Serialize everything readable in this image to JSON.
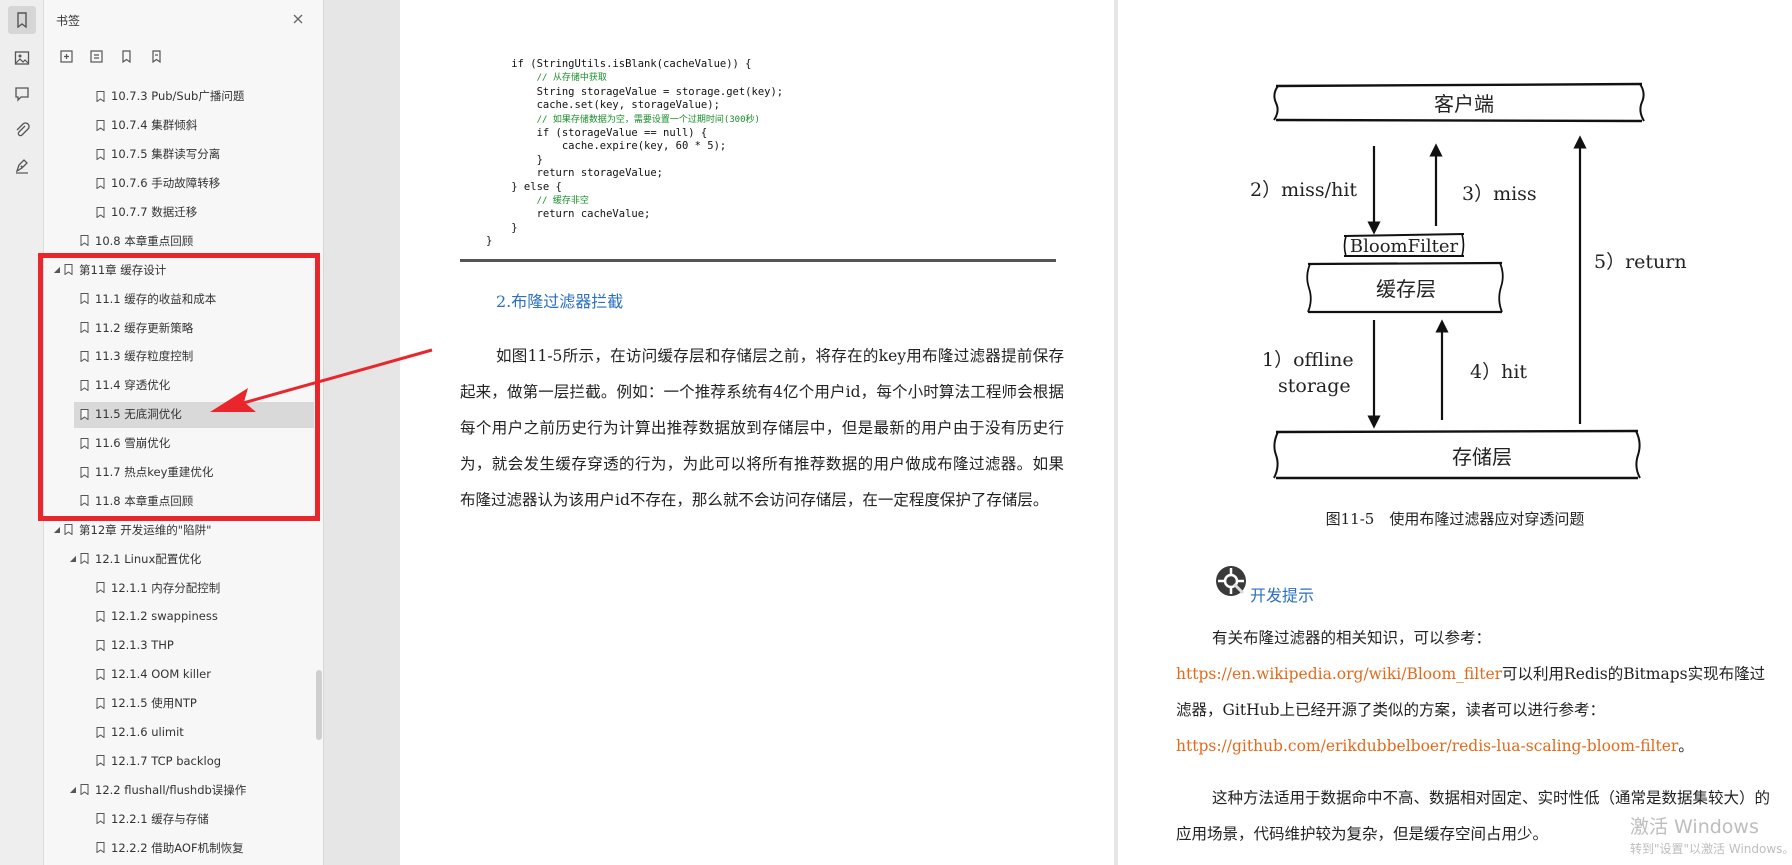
{
  "rail": {
    "items": [
      "bookmark-icon",
      "image-icon",
      "comment-icon",
      "attachment-icon",
      "signature-icon"
    ]
  },
  "panel": {
    "title": "书签",
    "tools": [
      "add-bookmark-icon",
      "delete-bookmark-icon",
      "expand-bookmark-icon",
      "collapse-bookmark-icon"
    ]
  },
  "tree": [
    {
      "label": "10.7.3 Pub/Sub广播问题",
      "level": 3,
      "caret": ""
    },
    {
      "label": "10.7.4 集群倾斜",
      "level": 3,
      "caret": ""
    },
    {
      "label": "10.7.5 集群读写分离",
      "level": 3,
      "caret": ""
    },
    {
      "label": "10.7.6 手动故障转移",
      "level": 3,
      "caret": ""
    },
    {
      "label": "10.7.7 数据迁移",
      "level": 3,
      "caret": ""
    },
    {
      "label": "10.8 本章重点回顾",
      "level": 2,
      "caret": ""
    },
    {
      "label": "第11章 缓存设计",
      "level": 1,
      "caret": "▲"
    },
    {
      "label": "11.1 缓存的收益和成本",
      "level": 2,
      "caret": ""
    },
    {
      "label": "11.2 缓存更新策略",
      "level": 2,
      "caret": ""
    },
    {
      "label": "11.3 缓存粒度控制",
      "level": 2,
      "caret": ""
    },
    {
      "label": "11.4 穿透优化",
      "level": 2,
      "caret": ""
    },
    {
      "label": "11.5 无底洞优化",
      "level": 2,
      "caret": "",
      "selected": true
    },
    {
      "label": "11.6 雪崩优化",
      "level": 2,
      "caret": ""
    },
    {
      "label": "11.7 热点key重建优化",
      "level": 2,
      "caret": ""
    },
    {
      "label": "11.8 本章重点回顾",
      "level": 2,
      "caret": ""
    },
    {
      "label": "第12章 开发运维的\"陷阱\"",
      "level": 1,
      "caret": "▲"
    },
    {
      "label": "12.1 Linux配置优化",
      "level": 2,
      "caret": "▲"
    },
    {
      "label": "12.1.1 内存分配控制",
      "level": 3,
      "caret": ""
    },
    {
      "label": "12.1.2 swappiness",
      "level": 3,
      "caret": ""
    },
    {
      "label": "12.1.3 THP",
      "level": 3,
      "caret": ""
    },
    {
      "label": "12.1.4 OOM killer",
      "level": 3,
      "caret": ""
    },
    {
      "label": "12.1.5 使用NTP",
      "level": 3,
      "caret": ""
    },
    {
      "label": "12.1.6 ulimit",
      "level": 3,
      "caret": ""
    },
    {
      "label": "12.1.7 TCP backlog",
      "level": 3,
      "caret": ""
    },
    {
      "label": "12.2 flushall/flushdb误操作",
      "level": 2,
      "caret": "▲"
    },
    {
      "label": "12.2.1 缓存与存储",
      "level": 3,
      "caret": ""
    },
    {
      "label": "12.2.2 借助AOF机制恢复",
      "level": 3,
      "caret": ""
    }
  ],
  "left_page": {
    "code_lines": [
      {
        "t": "    if (StringUtils.isBlank(cacheValue)) {",
        "c": false
      },
      {
        "t": "        // 从存储中获取",
        "c": true
      },
      {
        "t": "        String storageValue = storage.get(key);",
        "c": false
      },
      {
        "t": "        cache.set(key, storageValue);",
        "c": false
      },
      {
        "t": "        // 如果存储数据为空，需要设置一个过期时间(300秒)",
        "c": true
      },
      {
        "t": "        if (storageValue == null) {",
        "c": false
      },
      {
        "t": "            cache.expire(key, 60 * 5);",
        "c": false
      },
      {
        "t": "        }",
        "c": false
      },
      {
        "t": "        return storageValue;",
        "c": false
      },
      {
        "t": "    } else {",
        "c": false
      },
      {
        "t": "        // 缓存非空",
        "c": true
      },
      {
        "t": "        return cacheValue;",
        "c": false
      },
      {
        "t": "    }",
        "c": false
      },
      {
        "t": "}",
        "c": false
      }
    ],
    "section_title": "2.布隆过滤器拦截",
    "paragraph": "如图11-5所示，在访问缓存层和存储层之前，将存在的key用布隆过滤器提前保存起来，做第一层拦截。例如：一个推荐系统有4亿个用户id，每个小时算法工程师会根据每个用户之前历史行为计算出推荐数据放到存储层中，但是最新的用户由于没有历史行为，就会发生缓存穿透的行为，为此可以将所有推荐数据的用户做成布隆过滤器。如果布隆过滤器认为该用户id不存在，那么就不会访问存储层，在一定程度保护了存储层。"
  },
  "right_page": {
    "diagram": {
      "client": "客户端",
      "bloom": "BloomFilter",
      "cache": "缓存层",
      "storage": "存储层",
      "label_miss_hit": "2）miss/hit",
      "label_miss": "3）miss",
      "label_return": "5）return",
      "label_offline_1": "1）offline",
      "label_offline_2": "storage",
      "label_hit": "4）hit"
    },
    "caption": "图11-5　使用布隆过滤器应对穿透问题",
    "tip_title": "开发提示",
    "p1_a": "有关布隆过滤器的相关知识，可以参考：",
    "p1_link1": "https://en.wikipedia.org/wiki/Bloom_filter",
    "p1_b": "可以利用Redis的Bitmaps实现布隆过滤器，GitHub上已经开源了类似的方案，读者可以进行参考：",
    "p1_link2": "https://github.com/erikdubbelboer/redis-lua-scaling-bloom-filter",
    "p1_c": "。",
    "p2": "这种方法适用于数据命中不高、数据相对固定、实时性低（通常是数据集较大）的应用场景，代码维护较为复杂，但是缓存空间占用少。"
  },
  "watermark": {
    "line1": "激活 Windows",
    "line2": "转到\"设置\"以激活 Windows。"
  },
  "colors": {
    "highlight_red": "#e8262c",
    "link_blue": "#2a6fc4",
    "link_orange": "#e36a1a"
  }
}
